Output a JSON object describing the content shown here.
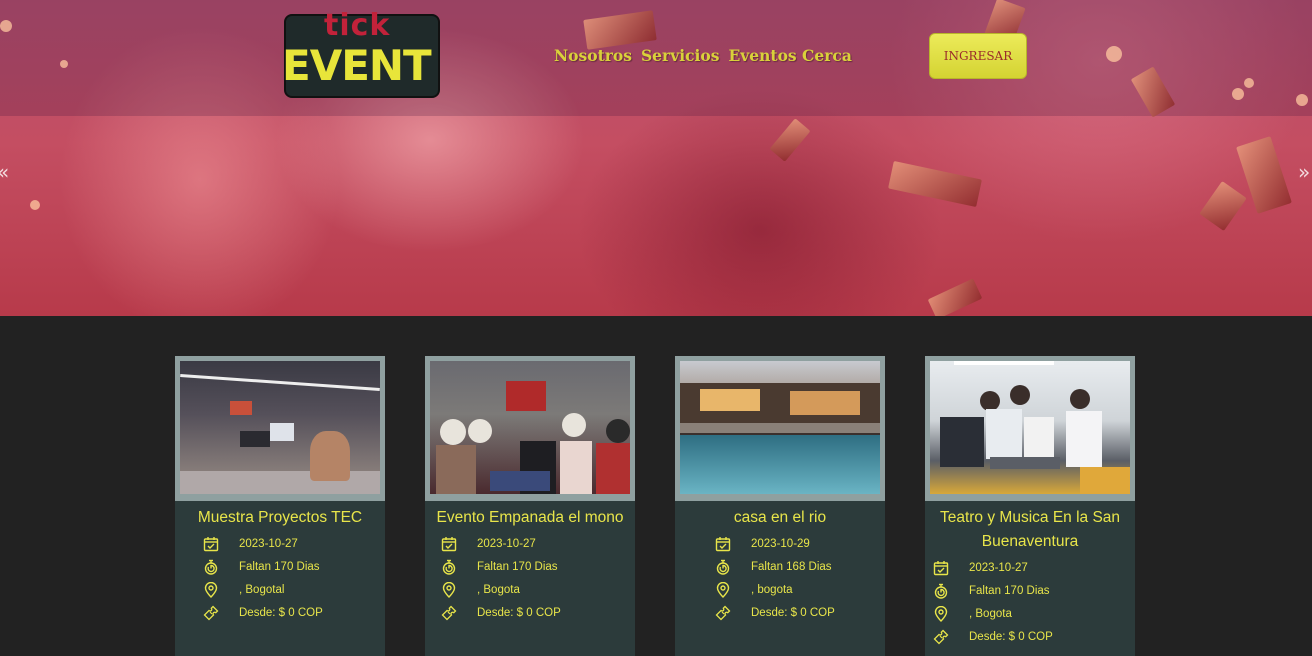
{
  "brand": {
    "logo_top": "tick",
    "logo_bottom": "EVENT"
  },
  "nav": [
    "Nosotros",
    "Servicios",
    "Eventos Cerca"
  ],
  "login_label": "INGRESAR",
  "carousel": {
    "prev": "«",
    "next": "»"
  },
  "events": [
    {
      "title": "Muestra Proyectos TEC",
      "date": "2023-10-27",
      "remaining": "Faltan 170 Dias",
      "location": ", Bogotal",
      "price": "Desde: $ 0 COP"
    },
    {
      "title": "Evento Empanada el mono",
      "date": "2023-10-27",
      "remaining": "Faltan 170 Dias",
      "location": ", Bogota",
      "price": "Desde: $ 0 COP"
    },
    {
      "title": "casa en el rio",
      "date": "2023-10-29",
      "remaining": "Faltan 168 Dias",
      "location": ", bogota",
      "price": "Desde: $ 0 COP"
    },
    {
      "title": "Teatro y Musica En la San Buenaventura",
      "date": "2023-10-27",
      "remaining": "Faltan 170 Dias",
      "location": ", Bogota",
      "price": "Desde: $ 0 COP"
    }
  ],
  "colors": {
    "accent": "#e8e54a",
    "card_bg": "#2c3b3b",
    "page_bg": "#222222",
    "nav_text": "#d9d13a",
    "logo_red": "#c2223a"
  },
  "icons": [
    "calendar-check-icon",
    "stopwatch-icon",
    "map-pin-icon",
    "ticket-icon"
  ]
}
